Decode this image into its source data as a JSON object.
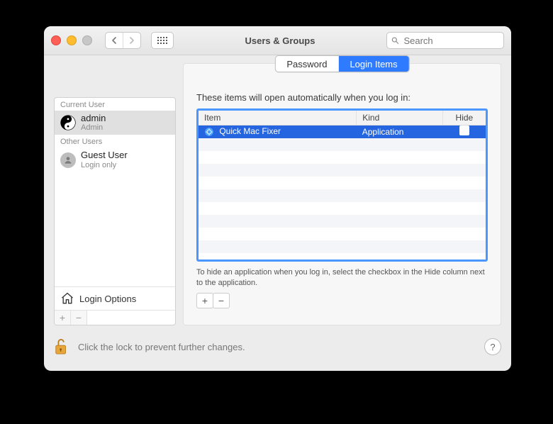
{
  "window": {
    "title": "Users & Groups"
  },
  "search": {
    "placeholder": "Search"
  },
  "sidebar": {
    "current_header": "Current User",
    "other_header": "Other Users",
    "current": {
      "name": "admin",
      "role": "Admin"
    },
    "other": {
      "name": "Guest User",
      "role": "Login only"
    },
    "login_options": "Login Options"
  },
  "segmented": {
    "password": "Password",
    "login_items": "Login Items"
  },
  "login_items": {
    "intro": "These items will open automatically when you log in:",
    "columns": {
      "item": "Item",
      "kind": "Kind",
      "hide": "Hide"
    },
    "rows": [
      {
        "name": "Quick Mac Fixer",
        "kind": "Application",
        "hide": false
      }
    ],
    "hint": "To hide an application when you log in, select the checkbox in the Hide column next to the application."
  },
  "footer": {
    "lock_text": "Click the lock to prevent further changes.",
    "help": "?"
  }
}
